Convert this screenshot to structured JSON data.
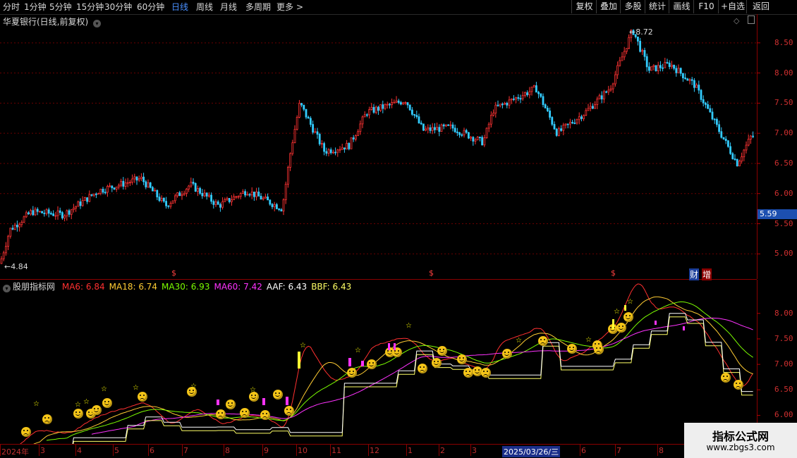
{
  "toolbar": {
    "left_items": [
      {
        "label": "分时",
        "active": false
      },
      {
        "label": "1分钟",
        "active": false
      },
      {
        "label": "5分钟",
        "active": false
      },
      {
        "label": "15分钟",
        "active": false
      },
      {
        "label": "30分钟",
        "active": false
      },
      {
        "label": "60分钟",
        "active": false
      },
      {
        "label": "日线",
        "active": true
      },
      {
        "label": "周线",
        "active": false
      },
      {
        "label": "月线",
        "active": false
      },
      {
        "label": "多周期",
        "active": false
      },
      {
        "label": "更多",
        "active": false
      }
    ],
    "right_items": [
      "复权",
      "叠加",
      "多股",
      "统计",
      "画线",
      "F10",
      "+自选",
      "返回"
    ],
    "more_arrow": ">"
  },
  "main_panel": {
    "title": "华夏银行(日线,前复权)",
    "price_axis": [
      "8.50",
      "8.00",
      "7.50",
      "7.00",
      "6.50",
      "6.00",
      "5.50",
      "5.00"
    ],
    "high_label": "8.72",
    "low_label": "4.84",
    "current_price": "5.59",
    "markers": [
      "$",
      "$",
      "$"
    ],
    "finance_tags": [
      "财",
      "增"
    ]
  },
  "indicator_panel": {
    "name": "股朋指标网",
    "legend": [
      {
        "label": "MA6: 6.84",
        "color": "#ff3030"
      },
      {
        "label": "MA18: 6.74",
        "color": "#ffcc33"
      },
      {
        "label": "MA30: 6.93",
        "color": "#7cfc00"
      },
      {
        "label": "MA60: 7.42",
        "color": "#ff33ff"
      },
      {
        "label": "AAF: 6.43",
        "color": "#ffffff"
      },
      {
        "label": "BBF: 6.43",
        "color": "#ffff66"
      }
    ],
    "axis": [
      "8.00",
      "7.50",
      "7.00",
      "6.50",
      "6.00"
    ]
  },
  "time_axis": [
    {
      "label": "2024年",
      "hl": false
    },
    {
      "label": "3",
      "hl": false
    },
    {
      "label": "4",
      "hl": false
    },
    {
      "label": "5",
      "hl": false
    },
    {
      "label": "6",
      "hl": false
    },
    {
      "label": "7",
      "hl": false
    },
    {
      "label": "8",
      "hl": false
    },
    {
      "label": "9",
      "hl": false
    },
    {
      "label": "10",
      "hl": false
    },
    {
      "label": "11",
      "hl": false
    },
    {
      "label": "12",
      "hl": false
    },
    {
      "label": "1",
      "hl": false
    },
    {
      "label": "2",
      "hl": false
    },
    {
      "label": "3",
      "hl": false
    },
    {
      "label": "2025/03/26/三",
      "hl": true
    },
    {
      "label": "6",
      "hl": false
    },
    {
      "label": "7",
      "hl": false
    },
    {
      "label": "8",
      "hl": false
    }
  ],
  "watermark": {
    "line1": "指标公式网",
    "line2": "www.zbgs3.com"
  },
  "colors": {
    "up": "#ff3333",
    "down": "#33ccff",
    "grid": "#6b0000",
    "axis": "#d03030"
  }
}
